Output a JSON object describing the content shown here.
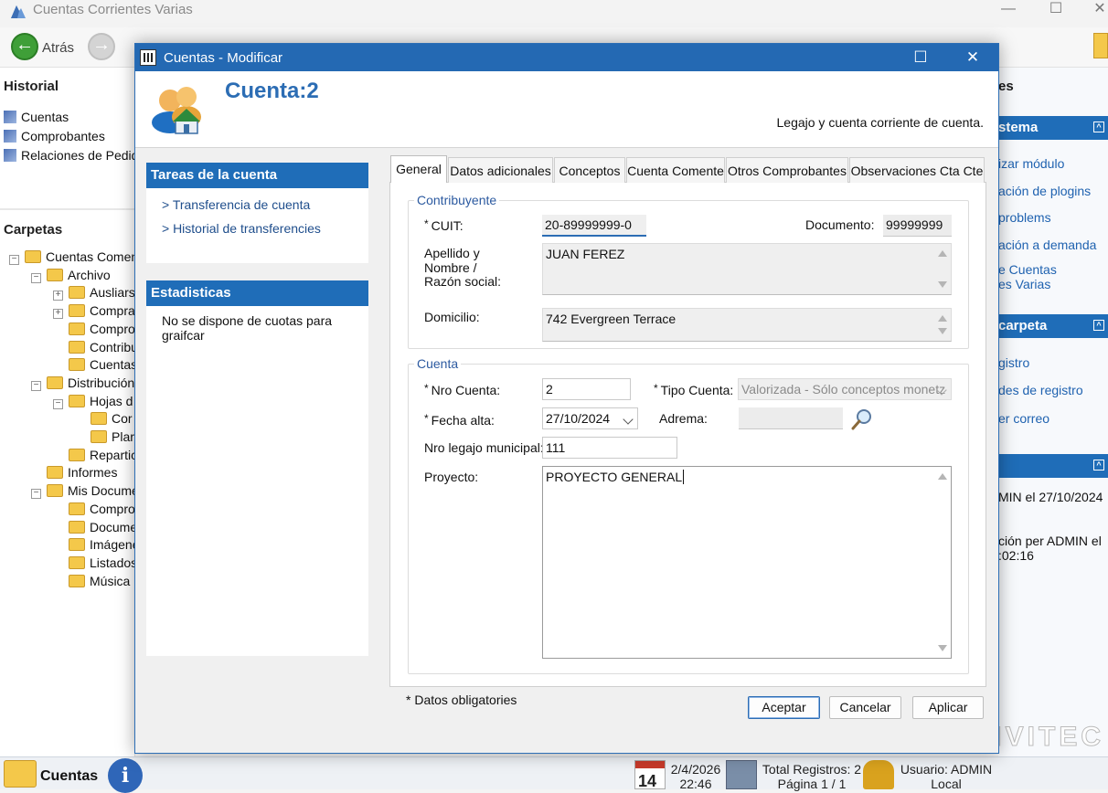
{
  "app": {
    "title": "Cuentas Corrientes Varias",
    "toolbar": {
      "back_label": "Atrás"
    },
    "window_controls": {
      "minimize": "—",
      "maximize": "☐",
      "close": "✕"
    },
    "historial": {
      "header": "Historial",
      "items": [
        "Cuentas",
        "Comprobantes",
        "Relaciones de Pedido"
      ]
    },
    "carpetas": {
      "header": "Carpetas",
      "tree": [
        {
          "label": "Cuentas Comen",
          "toggle": "−"
        },
        {
          "label": "Archivo",
          "toggle": "−"
        },
        {
          "label": "Ausliars",
          "toggle": "+"
        },
        {
          "label": "Compra",
          "toggle": "+"
        },
        {
          "label": "Compro",
          "toggle": ""
        },
        {
          "label": "Contribu",
          "toggle": ""
        },
        {
          "label": "Cuentas",
          "toggle": ""
        },
        {
          "label": "Distribución",
          "toggle": "−"
        },
        {
          "label": "Hojas d",
          "toggle": "−"
        },
        {
          "label": "Cor",
          "toggle": ""
        },
        {
          "label": "Plar",
          "toggle": ""
        },
        {
          "label": "Repartic",
          "toggle": ""
        },
        {
          "label": "Informes",
          "toggle": ""
        },
        {
          "label": "Mis Docume",
          "toggle": "−"
        },
        {
          "label": "Compro",
          "toggle": ""
        },
        {
          "label": "Docume",
          "toggle": ""
        },
        {
          "label": "Imágene",
          "toggle": ""
        },
        {
          "label": "Listados",
          "toggle": ""
        },
        {
          "label": "Música",
          "toggle": ""
        }
      ]
    },
    "right_panel": {
      "top_label": "es",
      "section1_title": "stema",
      "section1_links": [
        "izar módulo",
        "ación de plogins",
        "problems",
        "ación a demanda",
        "e Cuentas",
        "es Varias"
      ],
      "section2_title": "carpeta",
      "section2_links": [
        "gistro",
        "des de registro",
        "er correo"
      ],
      "section3_text1": "MIN el 27/10/2024",
      "section3_text2a": "ción per ADMIN el",
      "section3_text2b": ":02:16",
      "collapse_glyph": "^"
    },
    "statusbar": {
      "title": "Cuentas",
      "info_glyph": "i",
      "calendar_day": "14",
      "date": "2/4/2026",
      "time": "22:46",
      "total_registros": "Total Registros: 2",
      "pagina": "Página 1 / 1",
      "usuario": "Usuario: ADMIN",
      "ubicacion": "Local",
      "logo": "NVITEC"
    }
  },
  "dialog": {
    "title": "Cuentas - Modificar",
    "header": {
      "title": "Cuenta:2",
      "subtitle": "Legajo y cuenta corriente de cuenta."
    },
    "sidebar": {
      "tareas_title": "Tareas de la cuenta",
      "tareas_links": [
        "> Transferencia de cuenta",
        "> Historial de transferencies"
      ],
      "estadisticas_title": "Estadisticas",
      "estadisticas_text": "No se dispone de cuotas para graifcar"
    },
    "tabs": [
      "General",
      "Datos adicionales",
      "Conceptos",
      "Cuenta Comente",
      "Otros Comprobantes",
      "Observaciones Cta Cte"
    ],
    "active_tab": "General",
    "contribuyente": {
      "group_title": "Contribuyente",
      "cuit_label": "CUIT:",
      "cuit_value": "20-89999999-0",
      "documento_label": "Documento:",
      "documento_value": "99999999",
      "nombre_label_1": "Apellido y",
      "nombre_label_2": "Nombre /",
      "nombre_label_3": "Razón social:",
      "nombre_value": "JUAN FEREZ",
      "domicilio_label": "Domicilio:",
      "domicilio_value": "742 Evergreen Terrace"
    },
    "cuenta": {
      "group_title": "Cuenta",
      "nro_cuenta_label": "Nro Cuenta:",
      "nro_cuenta_value": "2",
      "tipo_cuenta_label": "Tipo Cuenta:",
      "tipo_cuenta_value": "Valorizada - Sólo conceptos monetz",
      "fecha_alta_label": "Fecha alta:",
      "fecha_alta_value": "27/10/2024",
      "adrema_label": "Adrema:",
      "adrema_value": "",
      "legajo_label": "Nro legajo municipal:",
      "legajo_value": "111",
      "proyecto_label": "Proyecto:",
      "proyecto_value": "PROYECTO GENERAL"
    },
    "required_marker": "*",
    "required_note": "* Datos obligatories",
    "buttons": {
      "accept": "Aceptar",
      "cancel": "Cancelar",
      "apply": "Aplicar"
    },
    "window_controls": {
      "maximize": "☐",
      "close": "✕"
    }
  }
}
